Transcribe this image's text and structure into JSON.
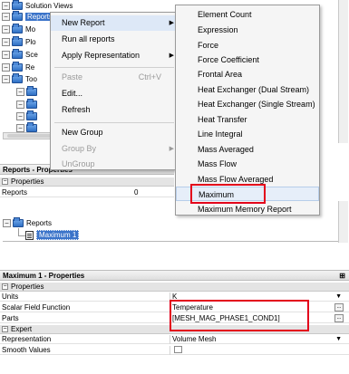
{
  "tree": {
    "nodes": [
      {
        "label": "Solution Views",
        "expanded": true
      },
      {
        "label": "Reports",
        "expanded": true,
        "selected": true
      },
      {
        "label": "Mo",
        "expanded": true
      },
      {
        "label": "Plo",
        "expanded": true
      },
      {
        "label": "Sce",
        "expanded": true
      },
      {
        "label": "Re",
        "expanded": true
      },
      {
        "label": "Too",
        "expanded": false
      }
    ],
    "folder_rows": [
      "",
      "",
      "",
      ""
    ]
  },
  "context_menu": {
    "items": [
      {
        "label": "New Report",
        "submenu_arrow": "▶"
      },
      {
        "label": "Run all reports"
      },
      {
        "label": "Apply Representation",
        "submenu_arrow": "▶"
      },
      {
        "label": "Paste",
        "shortcut": "Ctrl+V",
        "disabled": true
      },
      {
        "label": "Edit..."
      },
      {
        "label": "Refresh"
      },
      {
        "label": "New Group"
      },
      {
        "label": "Group By",
        "submenu_arrow": "▶",
        "disabled": true
      },
      {
        "label": "UnGroup",
        "disabled": true
      }
    ]
  },
  "submenu": {
    "items": [
      "Element Count",
      "Expression",
      "Force",
      "Force Coefficient",
      "Frontal Area",
      "Heat Exchanger (Dual Stream)",
      "Heat Exchanger (Single Stream)",
      "Heat Transfer",
      "Line Integral",
      "Mass Averaged",
      "Mass Flow",
      "Mass Flow Averaged",
      "Maximum",
      "Maximum Memory Report"
    ],
    "highlighted": "Maximum"
  },
  "reports_properties": {
    "title": "Reports - Properties",
    "category": "Properties",
    "rows": [
      {
        "name": "Reports",
        "value": "0"
      }
    ]
  },
  "mid_tree": {
    "parent": "Reports",
    "child": "Maximum 1"
  },
  "maximum_properties": {
    "title": "Maximum 1 - Properties",
    "categories": {
      "properties": "Properties",
      "expert": "Expert"
    },
    "rows": [
      {
        "name": "Units",
        "value": "K"
      },
      {
        "name": "Scalar Field Function",
        "value": "Temperature"
      },
      {
        "name": "Parts",
        "value": "[MESH_MAG_PHASE1_COND1]"
      }
    ],
    "expert_rows": [
      {
        "name": "Representation",
        "value": "Volume Mesh"
      },
      {
        "name": "Smooth Values",
        "value": ""
      }
    ],
    "mini_button": "...",
    "dropdown_arrow": "▼",
    "toggle_minus": "−"
  },
  "colors": {
    "highlight_red": "#e3001b",
    "selection_blue": "#3a73c9"
  }
}
